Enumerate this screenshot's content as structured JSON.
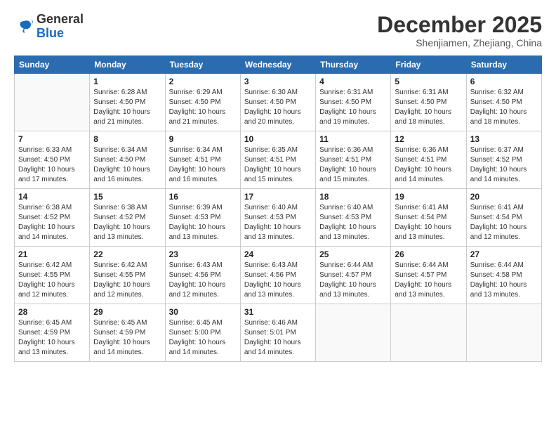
{
  "logo": {
    "general": "General",
    "blue": "Blue"
  },
  "header": {
    "month": "December 2025",
    "location": "Shenjiamen, Zhejiang, China"
  },
  "weekdays": [
    "Sunday",
    "Monday",
    "Tuesday",
    "Wednesday",
    "Thursday",
    "Friday",
    "Saturday"
  ],
  "weeks": [
    [
      {
        "date": "",
        "info": ""
      },
      {
        "date": "1",
        "info": "Sunrise: 6:28 AM\nSunset: 4:50 PM\nDaylight: 10 hours and 21 minutes."
      },
      {
        "date": "2",
        "info": "Sunrise: 6:29 AM\nSunset: 4:50 PM\nDaylight: 10 hours and 21 minutes."
      },
      {
        "date": "3",
        "info": "Sunrise: 6:30 AM\nSunset: 4:50 PM\nDaylight: 10 hours and 20 minutes."
      },
      {
        "date": "4",
        "info": "Sunrise: 6:31 AM\nSunset: 4:50 PM\nDaylight: 10 hours and 19 minutes."
      },
      {
        "date": "5",
        "info": "Sunrise: 6:31 AM\nSunset: 4:50 PM\nDaylight: 10 hours and 18 minutes."
      },
      {
        "date": "6",
        "info": "Sunrise: 6:32 AM\nSunset: 4:50 PM\nDaylight: 10 hours and 18 minutes."
      }
    ],
    [
      {
        "date": "7",
        "info": "Sunrise: 6:33 AM\nSunset: 4:50 PM\nDaylight: 10 hours and 17 minutes."
      },
      {
        "date": "8",
        "info": "Sunrise: 6:34 AM\nSunset: 4:50 PM\nDaylight: 10 hours and 16 minutes."
      },
      {
        "date": "9",
        "info": "Sunrise: 6:34 AM\nSunset: 4:51 PM\nDaylight: 10 hours and 16 minutes."
      },
      {
        "date": "10",
        "info": "Sunrise: 6:35 AM\nSunset: 4:51 PM\nDaylight: 10 hours and 15 minutes."
      },
      {
        "date": "11",
        "info": "Sunrise: 6:36 AM\nSunset: 4:51 PM\nDaylight: 10 hours and 15 minutes."
      },
      {
        "date": "12",
        "info": "Sunrise: 6:36 AM\nSunset: 4:51 PM\nDaylight: 10 hours and 14 minutes."
      },
      {
        "date": "13",
        "info": "Sunrise: 6:37 AM\nSunset: 4:52 PM\nDaylight: 10 hours and 14 minutes."
      }
    ],
    [
      {
        "date": "14",
        "info": "Sunrise: 6:38 AM\nSunset: 4:52 PM\nDaylight: 10 hours and 14 minutes."
      },
      {
        "date": "15",
        "info": "Sunrise: 6:38 AM\nSunset: 4:52 PM\nDaylight: 10 hours and 13 minutes."
      },
      {
        "date": "16",
        "info": "Sunrise: 6:39 AM\nSunset: 4:53 PM\nDaylight: 10 hours and 13 minutes."
      },
      {
        "date": "17",
        "info": "Sunrise: 6:40 AM\nSunset: 4:53 PM\nDaylight: 10 hours and 13 minutes."
      },
      {
        "date": "18",
        "info": "Sunrise: 6:40 AM\nSunset: 4:53 PM\nDaylight: 10 hours and 13 minutes."
      },
      {
        "date": "19",
        "info": "Sunrise: 6:41 AM\nSunset: 4:54 PM\nDaylight: 10 hours and 13 minutes."
      },
      {
        "date": "20",
        "info": "Sunrise: 6:41 AM\nSunset: 4:54 PM\nDaylight: 10 hours and 12 minutes."
      }
    ],
    [
      {
        "date": "21",
        "info": "Sunrise: 6:42 AM\nSunset: 4:55 PM\nDaylight: 10 hours and 12 minutes."
      },
      {
        "date": "22",
        "info": "Sunrise: 6:42 AM\nSunset: 4:55 PM\nDaylight: 10 hours and 12 minutes."
      },
      {
        "date": "23",
        "info": "Sunrise: 6:43 AM\nSunset: 4:56 PM\nDaylight: 10 hours and 12 minutes."
      },
      {
        "date": "24",
        "info": "Sunrise: 6:43 AM\nSunset: 4:56 PM\nDaylight: 10 hours and 13 minutes."
      },
      {
        "date": "25",
        "info": "Sunrise: 6:44 AM\nSunset: 4:57 PM\nDaylight: 10 hours and 13 minutes."
      },
      {
        "date": "26",
        "info": "Sunrise: 6:44 AM\nSunset: 4:57 PM\nDaylight: 10 hours and 13 minutes."
      },
      {
        "date": "27",
        "info": "Sunrise: 6:44 AM\nSunset: 4:58 PM\nDaylight: 10 hours and 13 minutes."
      }
    ],
    [
      {
        "date": "28",
        "info": "Sunrise: 6:45 AM\nSunset: 4:59 PM\nDaylight: 10 hours and 13 minutes."
      },
      {
        "date": "29",
        "info": "Sunrise: 6:45 AM\nSunset: 4:59 PM\nDaylight: 10 hours and 14 minutes."
      },
      {
        "date": "30",
        "info": "Sunrise: 6:45 AM\nSunset: 5:00 PM\nDaylight: 10 hours and 14 minutes."
      },
      {
        "date": "31",
        "info": "Sunrise: 6:46 AM\nSunset: 5:01 PM\nDaylight: 10 hours and 14 minutes."
      },
      {
        "date": "",
        "info": ""
      },
      {
        "date": "",
        "info": ""
      },
      {
        "date": "",
        "info": ""
      }
    ]
  ]
}
